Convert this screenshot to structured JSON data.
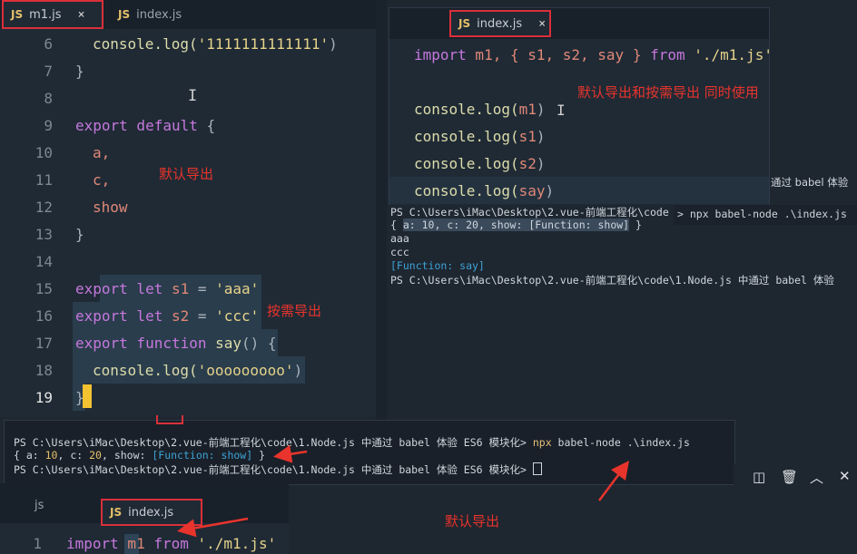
{
  "left_editor": {
    "tabs": [
      {
        "icon": "JS",
        "label": "m1.js",
        "close": "×"
      },
      {
        "icon": "JS",
        "label": "index.js"
      }
    ],
    "line_numbers": [
      "6",
      "7",
      "8",
      "9",
      "10",
      "11",
      "12",
      "13",
      "14",
      "15",
      "16",
      "17",
      "18",
      "19"
    ],
    "lines": {
      "l6": {
        "fn": "console.log(",
        "str": "'1111111111111'",
        "end": ")"
      },
      "l7": "}",
      "l9": {
        "kw": "export default",
        "pun": " {"
      },
      "l10": "a,",
      "l11": "c,",
      "l12": "show",
      "l13": "}",
      "l15": {
        "kw": "export let",
        "name": " s1",
        "op": " = ",
        "str": "'aaa'"
      },
      "l16": {
        "kw": "export let",
        "name": " s2",
        "op": " = ",
        "str": "'ccc'"
      },
      "l17": {
        "kw": "export function",
        "fn": " say",
        "pun": "() {"
      },
      "l18": {
        "fn": "console.log(",
        "str": "'ooooooooo'",
        "end": ")"
      },
      "l19": "}"
    },
    "annotations": {
      "default_export": "默认导出",
      "named_export": "按需导出"
    }
  },
  "right_editor": {
    "tab": {
      "icon": "JS",
      "label": "index.js",
      "close": "×"
    },
    "lines": [
      {
        "kw": "import",
        "rest": " m1, { s1, s2, say } ",
        "kw2": "from",
        "str": " './m1.js'"
      },
      {
        "fn": "console.log(",
        "arg": "m1",
        "end": ")"
      },
      {
        "fn": "console.log(",
        "arg": "s1",
        "end": ")"
      },
      {
        "fn": "console.log(",
        "arg": "s2",
        "end": ")"
      },
      {
        "fn": "console.log(",
        "arg": "say",
        "end": ")"
      }
    ],
    "annotation": "默认导出和按需导出 同时使用"
  },
  "right_terminal": {
    "right_snippet_1": "通过 babel 体验",
    "right_snippet_2": "> npx babel-node .\\index.js",
    "lines": {
      "prompt1": "PS C:\\Users\\iMac\\Desktop\\2.vue-前端工程化\\code",
      "obj_open": "{ ",
      "obj_body": "a: 10, c: 20, show: [Function: show]",
      "obj_close": " }",
      "aaa": "aaa",
      "ccc": "ccc",
      "fn": "[Function: say]",
      "prompt2": "PS C:\\Users\\iMac\\Desktop\\2.vue-前端工程化\\code\\1.Node.js 中通过 babel 体验"
    }
  },
  "bottom_terminal": {
    "line1_prefix": "PS C:\\Users\\iMac\\Desktop\\2.vue-前端工程化\\code\\1.Node.js 中通过 babel 体验 ES6 模块化> ",
    "line1_cmd": "npx",
    "line1_rest": " babel-node .\\index.js",
    "line2": {
      "open": "{ a: ",
      "a": "10",
      "mid": ", c: ",
      "c": "20",
      "show": ", show: ",
      "fn": "[Function: show]",
      "close": " }"
    },
    "line3": "PS C:\\Users\\iMac\\Desktop\\2.vue-前端工程化\\code\\1.Node.js 中通过 babel 体验 ES6 模块化> "
  },
  "bottom_editor": {
    "tabs": [
      {
        "label": "js"
      },
      {
        "icon": "JS",
        "label": "index.js"
      }
    ],
    "line_number": "1",
    "code": {
      "kw": "import",
      "name": " m1",
      "kw2": " from",
      "str": " './m1.js'"
    },
    "annotation": "默认导出"
  },
  "panel_icons": [
    "split-editor-icon",
    "trash-icon",
    "chevron-up-icon",
    "close-icon"
  ],
  "colors": {
    "accent_red": "#d9303a",
    "annotation_red": "#e8342c",
    "editor_bg": "#1f2a35"
  }
}
